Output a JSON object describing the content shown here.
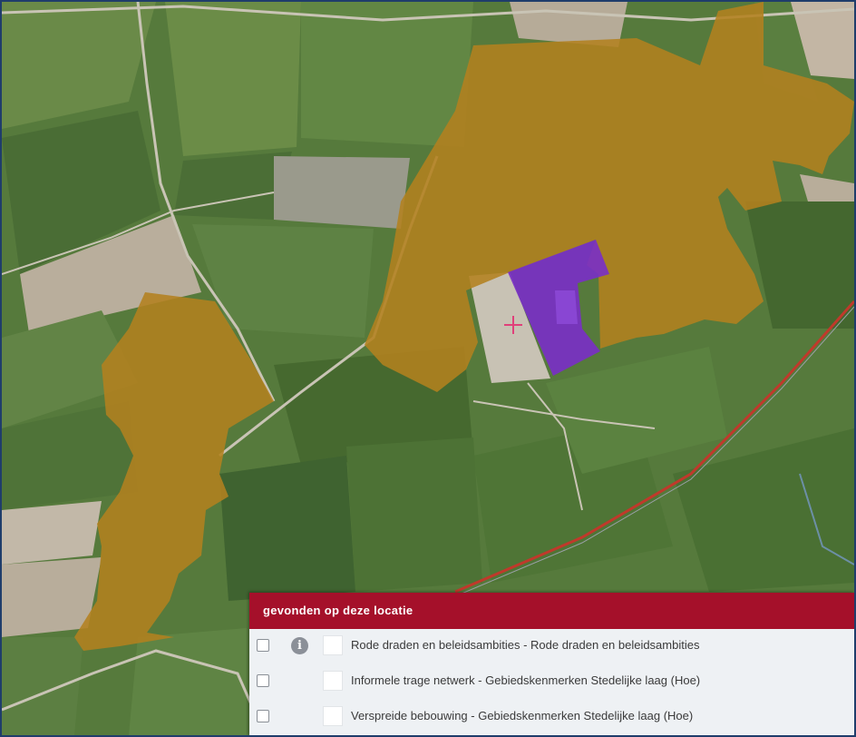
{
  "map": {
    "colors": {
      "field": "#567a3c",
      "field_light": "#6f8f4c",
      "field_dark": "#3f5f30",
      "bare_field": "#b5ab99",
      "road": "#c9c4b5",
      "railway": "#c0392b",
      "zone_orange": "#b3811f",
      "zone_purple": "#7a2dc8",
      "crosshair": "#e0407a"
    },
    "marker_icon": "crosshair-icon"
  },
  "legend": {
    "header": "gevonden op deze locatie",
    "colors": {
      "header_bg": "#a5102a",
      "panel_bg": "#eef1f4"
    },
    "items": [
      {
        "label": "Rode draden en beleidsambities - Rode draden en beleidsambities",
        "has_info": true,
        "info_glyph": "i"
      },
      {
        "label": "Informele trage netwerk - Gebiedskenmerken Stedelijke laag (Hoe)",
        "has_info": false
      },
      {
        "label": "Verspreide bebouwing - Gebiedskenmerken Stedelijke laag (Hoe)",
        "has_info": false
      }
    ]
  }
}
